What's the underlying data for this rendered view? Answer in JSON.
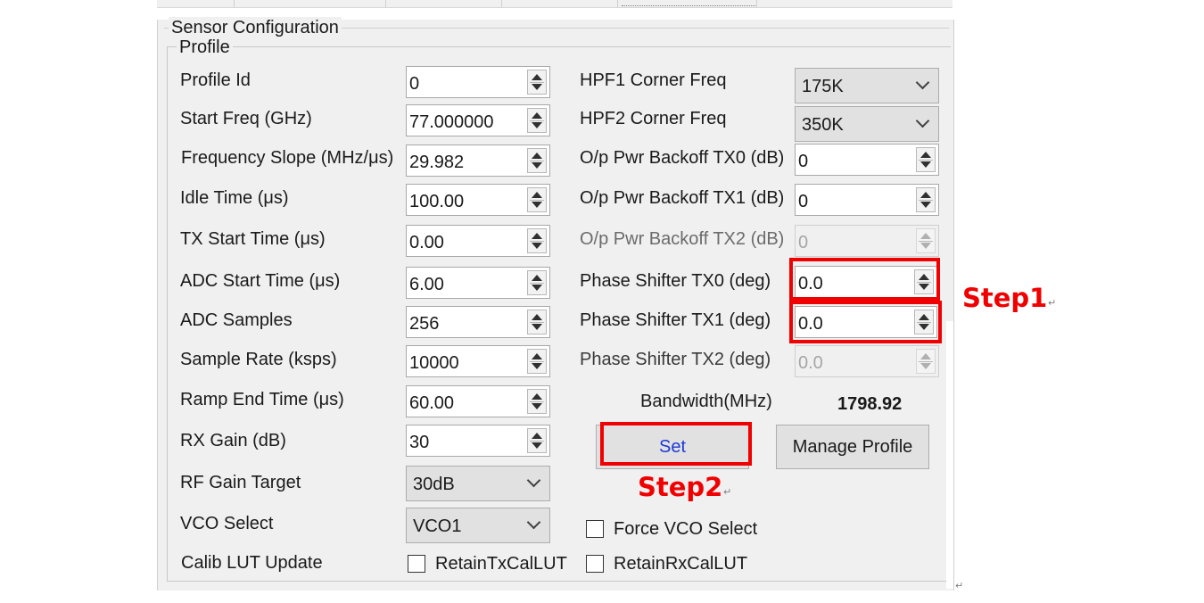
{
  "window": {
    "group_title": "Sensor Configuration",
    "profile_title": "Profile"
  },
  "left": {
    "profile_id": {
      "label": "Profile Id",
      "value": "0"
    },
    "start_freq": {
      "label": "Start Freq (GHz)",
      "value": "77.000000"
    },
    "freq_slope": {
      "label": "Frequency Slope (MHz/μs)",
      "value": "29.982"
    },
    "idle_time": {
      "label": "Idle Time (μs)",
      "value": "100.00"
    },
    "tx_start_time": {
      "label": "TX Start Time (μs)",
      "value": "0.00"
    },
    "adc_start_time": {
      "label": "ADC Start Time (μs)",
      "value": "6.00"
    },
    "adc_samples": {
      "label": "ADC Samples",
      "value": "256"
    },
    "sample_rate": {
      "label": "Sample Rate (ksps)",
      "value": "10000"
    },
    "ramp_end_time": {
      "label": "Ramp End Time (μs)",
      "value": "60.00"
    },
    "rx_gain": {
      "label": "RX Gain (dB)",
      "value": "30"
    },
    "rf_gain_target": {
      "label": "RF Gain Target",
      "value": "30dB"
    },
    "vco_select": {
      "label": "VCO Select",
      "value": "VCO1"
    },
    "calib_lut": {
      "label": "Calib LUT Update",
      "retain_tx": "RetainTxCalLUT",
      "retain_rx": "RetainRxCalLUT"
    }
  },
  "right": {
    "hpf1": {
      "label": "HPF1 Corner Freq",
      "value": "175K"
    },
    "hpf2": {
      "label": "HPF2 Corner Freq",
      "value": "350K"
    },
    "backoff_tx0": {
      "label": "O/p Pwr Backoff TX0 (dB)",
      "value": "0"
    },
    "backoff_tx1": {
      "label": "O/p Pwr Backoff TX1 (dB)",
      "value": "0"
    },
    "backoff_tx2": {
      "label": "O/p Pwr Backoff TX2 (dB)",
      "value": "0"
    },
    "phase_tx0": {
      "label": "Phase Shifter TX0 (deg)",
      "value": "0.0"
    },
    "phase_tx1": {
      "label": "Phase Shifter TX1 (deg)",
      "value": "0.0"
    },
    "phase_tx2": {
      "label": "Phase Shifter TX2 (deg)",
      "value": "0.0"
    },
    "bandwidth": {
      "label": "Bandwidth(MHz)",
      "value": "1798.92"
    },
    "set_label": "Set",
    "manage_label": "Manage Profile",
    "force_vco_label": "Force VCO Select"
  },
  "annotations": {
    "step1": "Step1",
    "step2": "Step2",
    "return_mark": "↵"
  },
  "colors": {
    "annotation": "#f00000",
    "set_text": "#1f39d6",
    "panel_bg": "#f0f0f0"
  }
}
